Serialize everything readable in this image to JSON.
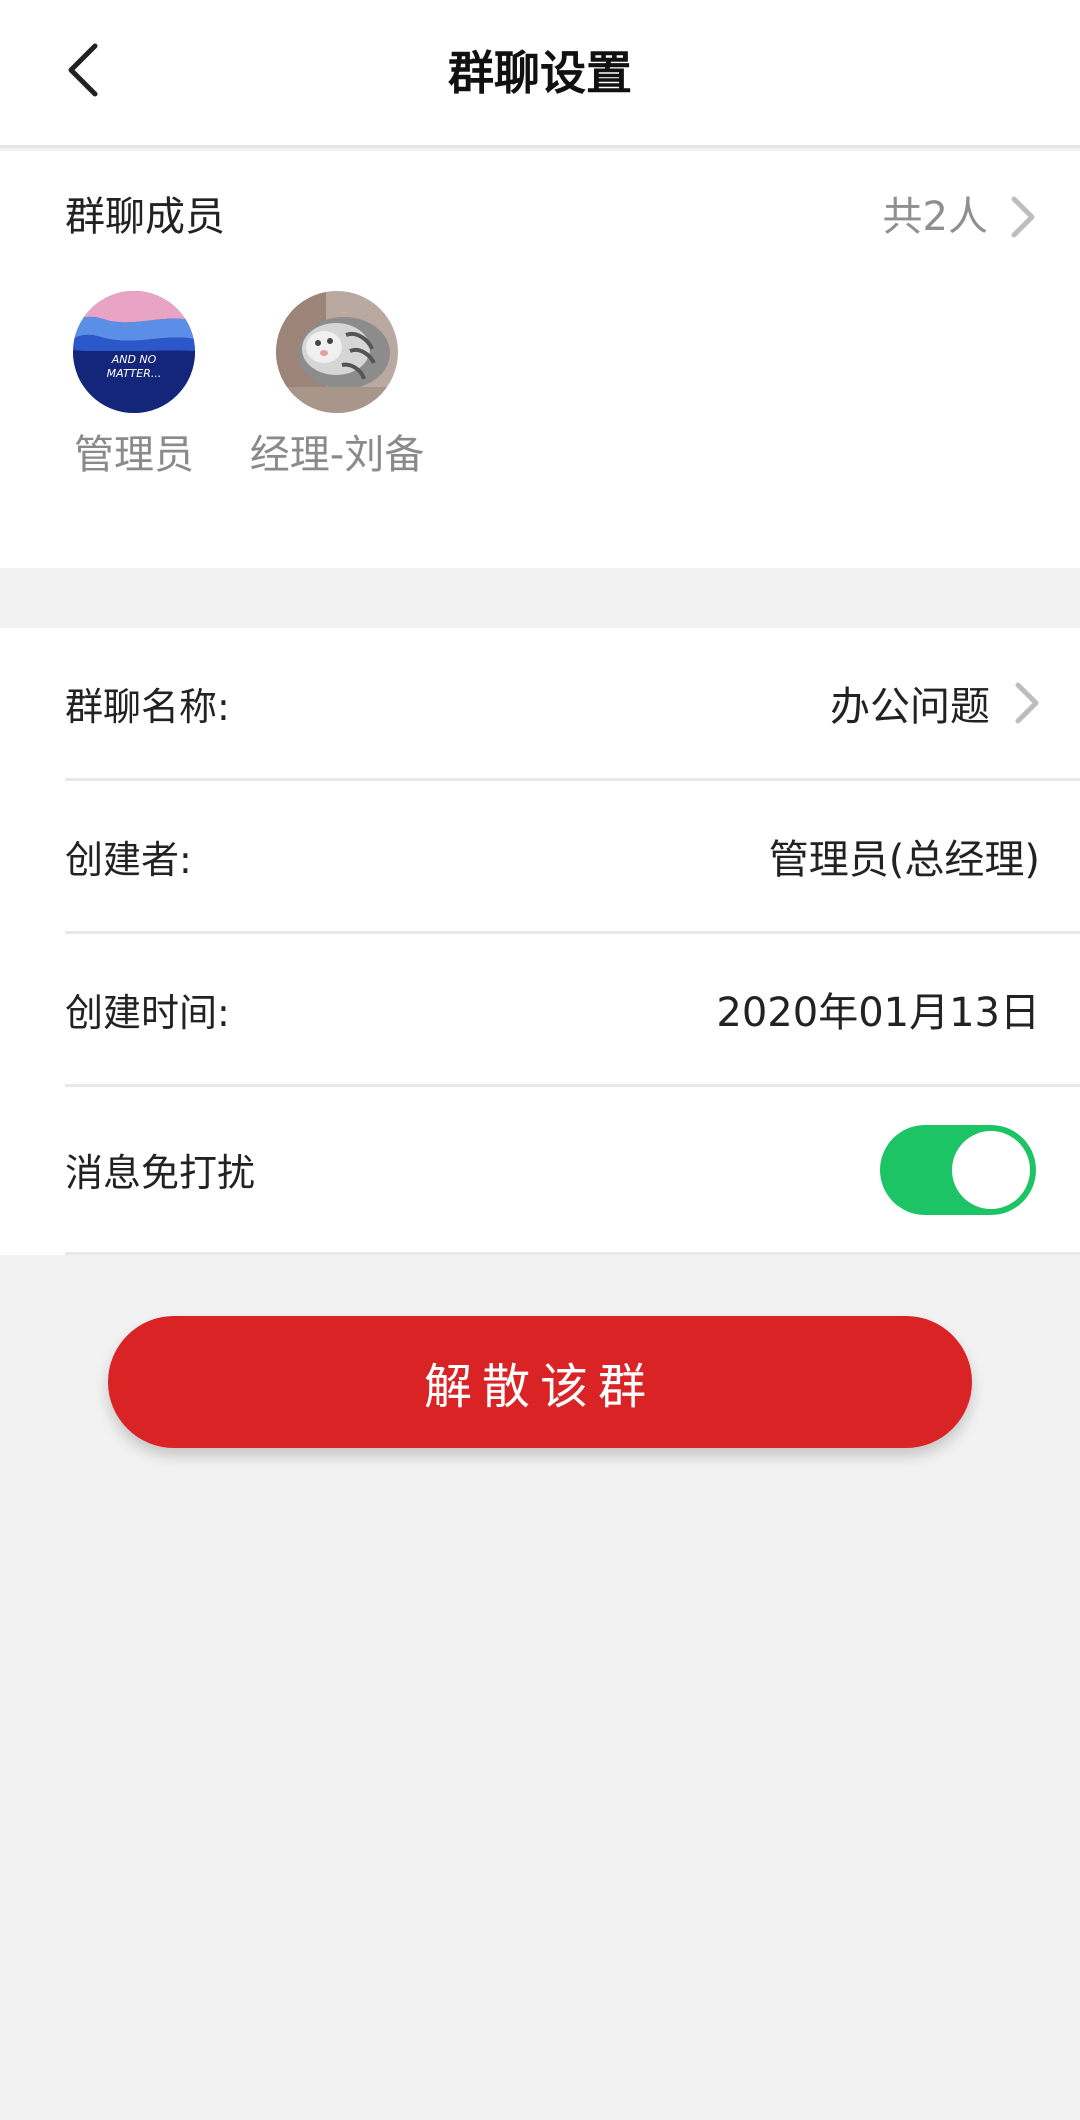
{
  "header": {
    "title": "群聊设置",
    "back_icon": "chevron-left-icon"
  },
  "members": {
    "title": "群聊成员",
    "count_text": "共2人",
    "list": [
      {
        "name": "管理员",
        "avatar_caption": "AND NO MATTER..."
      },
      {
        "name": "经理-刘备"
      }
    ]
  },
  "info": {
    "group_name_label": "群聊名称:",
    "group_name_value": "办公问题",
    "creator_label": "创建者:",
    "creator_value": "管理员(总经理)",
    "created_time_label": "创建时间:",
    "created_time_value": "2020年01月13日",
    "dnd_label": "消息免打扰",
    "dnd_enabled": true
  },
  "actions": {
    "dissolve_label": "解散该群"
  },
  "colors": {
    "accent_red": "#d92325",
    "toggle_green": "#1dc466",
    "background": "#f2f2f2"
  }
}
